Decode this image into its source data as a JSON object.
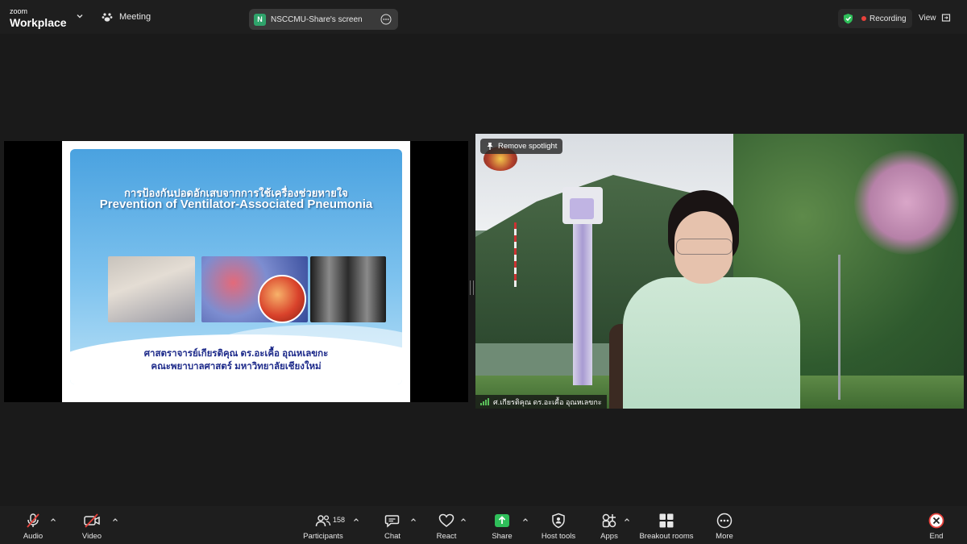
{
  "app": {
    "brand_small": "zoom",
    "brand_big": "Workplace",
    "meeting_label": "Meeting"
  },
  "share_pill": {
    "badge": "N",
    "label": "NSCCMU-Share's screen"
  },
  "status": {
    "recording_label": "Recording",
    "view_label": "View"
  },
  "slide": {
    "thai_title": "การป้องกันปอดอักเสบจากการใช้เครื่องช่วยหายใจ",
    "title": "Prevention of Ventilator-Associated Pneumonia",
    "author": "ศาสตราจารย์เกียรติคุณ ดร.อะเคื้อ อุณหเลขกะ",
    "faculty": "คณะพยาบาลศาสตร์ มหาวิทยาลัยเชียงใหม่"
  },
  "video": {
    "spotlight_label": "Remove spotlight",
    "participant_name": "ศ.เกียรติคุณ ดร.อะเคื้อ อุณหเลขกะ"
  },
  "toolbar": {
    "audio_label": "Audio",
    "video_label": "Video",
    "participants_label": "Participants",
    "participants_count": "158",
    "chat_label": "Chat",
    "react_label": "React",
    "share_label": "Share",
    "host_tools_label": "Host tools",
    "apps_label": "Apps",
    "breakout_label": "Breakout rooms",
    "more_label": "More",
    "end_label": "End"
  },
  "colors": {
    "background": "#1a1a1a",
    "bar": "#1e1e1e",
    "share_green": "#2fa36b",
    "recording_red": "#e8413b",
    "end_red": "#e8413b"
  }
}
